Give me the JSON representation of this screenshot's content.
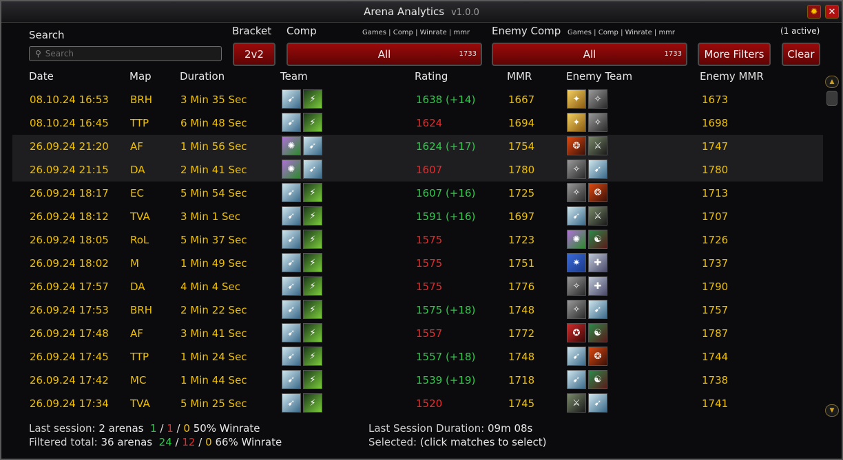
{
  "window": {
    "title": "Arena Analytics",
    "version": "v1.0.0"
  },
  "filters": {
    "search_label": "Search",
    "search_placeholder": "Search",
    "bracket_label": "Bracket",
    "bracket_value": "2v2",
    "comp_label": "Comp",
    "comp_stats_header": "Games | Comp | Winrate | mmr",
    "comp_value": "All",
    "comp_count": "1733",
    "enemy_comp_label": "Enemy Comp",
    "enemy_comp_stats_header": "Games | Comp | Winrate | mmr",
    "enemy_comp_value": "All",
    "enemy_comp_count": "1733",
    "active_filters": "(1 active)",
    "more_filters_label": "More Filters",
    "clear_label": "Clear"
  },
  "columns": [
    "Date",
    "Map",
    "Duration",
    "Team",
    "Rating",
    "MMR",
    "Enemy Team",
    "Enemy MMR"
  ],
  "matches": [
    {
      "date": "08.10.24  16:53",
      "map": "BRH",
      "duration": "3 Min 35 Sec",
      "rating": "1638 (+14)",
      "result": "win",
      "mmr": "1667",
      "enemy_mmr": "1673",
      "team": [
        "hunter-icon",
        "shaman-icon"
      ],
      "enemy": [
        "paladin-icon",
        "rogue-icon"
      ]
    },
    {
      "date": "08.10.24  16:45",
      "map": "TTP",
      "duration": "6 Min 48 Sec",
      "rating": "1624",
      "result": "loss",
      "mmr": "1694",
      "enemy_mmr": "1698",
      "team": [
        "hunter-icon",
        "shaman-icon"
      ],
      "enemy": [
        "paladin-icon",
        "rogue-icon"
      ]
    },
    {
      "date": "26.09.24  21:20",
      "map": "AF",
      "duration": "1 Min 56 Sec",
      "rating": "1624 (+17)",
      "result": "win",
      "mmr": "1754",
      "enemy_mmr": "1747",
      "team": [
        "warlock-icon",
        "hunter-icon"
      ],
      "enemy": [
        "druid-icon",
        "warrior-icon"
      ]
    },
    {
      "date": "26.09.24  21:15",
      "map": "DA",
      "duration": "2 Min 41 Sec",
      "rating": "1607",
      "result": "loss",
      "mmr": "1780",
      "enemy_mmr": "1780",
      "team": [
        "warlock-icon",
        "hunter-icon"
      ],
      "enemy": [
        "rogue-icon",
        "hunter-icon"
      ]
    },
    {
      "date": "26.09.24  18:17",
      "map": "EC",
      "duration": "5 Min 54 Sec",
      "rating": "1607 (+16)",
      "result": "win",
      "mmr": "1725",
      "enemy_mmr": "1713",
      "team": [
        "hunter-icon",
        "shaman-icon"
      ],
      "enemy": [
        "rogue-icon",
        "druid-icon"
      ]
    },
    {
      "date": "26.09.24  18:12",
      "map": "TVA",
      "duration": "3 Min 1 Sec",
      "rating": "1591 (+16)",
      "result": "win",
      "mmr": "1697",
      "enemy_mmr": "1707",
      "team": [
        "hunter-icon",
        "shaman-icon"
      ],
      "enemy": [
        "hunter-icon",
        "warrior-icon"
      ]
    },
    {
      "date": "26.09.24  18:05",
      "map": "RoL",
      "duration": "5 Min 37 Sec",
      "rating": "1575",
      "result": "loss",
      "mmr": "1723",
      "enemy_mmr": "1726",
      "team": [
        "hunter-icon",
        "shaman-icon"
      ],
      "enemy": [
        "warlock-icon",
        "monk-icon"
      ]
    },
    {
      "date": "26.09.24  18:02",
      "map": "M",
      "duration": "1 Min 49 Sec",
      "rating": "1575",
      "result": "loss",
      "mmr": "1751",
      "enemy_mmr": "1737",
      "team": [
        "hunter-icon",
        "shaman-icon"
      ],
      "enemy": [
        "mage-icon",
        "priest-icon"
      ]
    },
    {
      "date": "26.09.24  17:57",
      "map": "DA",
      "duration": "4 Min 4 Sec",
      "rating": "1575",
      "result": "loss",
      "mmr": "1776",
      "enemy_mmr": "1790",
      "team": [
        "hunter-icon",
        "shaman-icon"
      ],
      "enemy": [
        "rogue-icon",
        "priest-icon"
      ]
    },
    {
      "date": "26.09.24  17:53",
      "map": "BRH",
      "duration": "2 Min 22 Sec",
      "rating": "1575 (+18)",
      "result": "win",
      "mmr": "1748",
      "enemy_mmr": "1757",
      "team": [
        "hunter-icon",
        "shaman-icon"
      ],
      "enemy": [
        "rogue-icon",
        "hunter-icon"
      ]
    },
    {
      "date": "26.09.24  17:48",
      "map": "AF",
      "duration": "3 Min 41 Sec",
      "rating": "1557",
      "result": "loss",
      "mmr": "1772",
      "enemy_mmr": "1787",
      "team": [
        "hunter-icon",
        "shaman-icon"
      ],
      "enemy": [
        "demonhunter-icon",
        "monk-icon"
      ]
    },
    {
      "date": "26.09.24  17:45",
      "map": "TTP",
      "duration": "1 Min 24 Sec",
      "rating": "1557 (+18)",
      "result": "win",
      "mmr": "1748",
      "enemy_mmr": "1744",
      "team": [
        "hunter-icon",
        "shaman-icon"
      ],
      "enemy": [
        "hunter-icon",
        "druid-icon"
      ]
    },
    {
      "date": "26.09.24  17:42",
      "map": "MC",
      "duration": "1 Min 44 Sec",
      "rating": "1539 (+19)",
      "result": "win",
      "mmr": "1718",
      "enemy_mmr": "1738",
      "team": [
        "hunter-icon",
        "shaman-icon"
      ],
      "enemy": [
        "hunter-icon",
        "monk-icon"
      ]
    },
    {
      "date": "26.09.24  17:34",
      "map": "TVA",
      "duration": "5 Min 25 Sec",
      "rating": "1520",
      "result": "loss",
      "mmr": "1745",
      "enemy_mmr": "1741",
      "team": [
        "hunter-icon",
        "shaman-icon"
      ],
      "enemy": [
        "warrior-icon",
        "hunter-icon"
      ]
    }
  ],
  "footer": {
    "last_session_label": "Last session:",
    "last_session_arenas": "2 arenas",
    "last_session_wins": "1",
    "last_session_losses": "1",
    "last_session_draws": "0",
    "last_session_winrate": "50% Winrate",
    "filtered_label": "Filtered total:",
    "filtered_arenas": "36 arenas",
    "filtered_wins": "24",
    "filtered_losses": "12",
    "filtered_draws": "0",
    "filtered_winrate": "66% Winrate",
    "sep": "/",
    "duration_label": "Last Session Duration:",
    "duration_value": "09m 08s",
    "selected_label": "Selected:",
    "selected_value": "(click matches to select)"
  },
  "colors": {
    "accent_gold": "#f0c000",
    "win": "#2fc94a",
    "loss": "#e82a2a",
    "button_red": "#8a0808"
  }
}
